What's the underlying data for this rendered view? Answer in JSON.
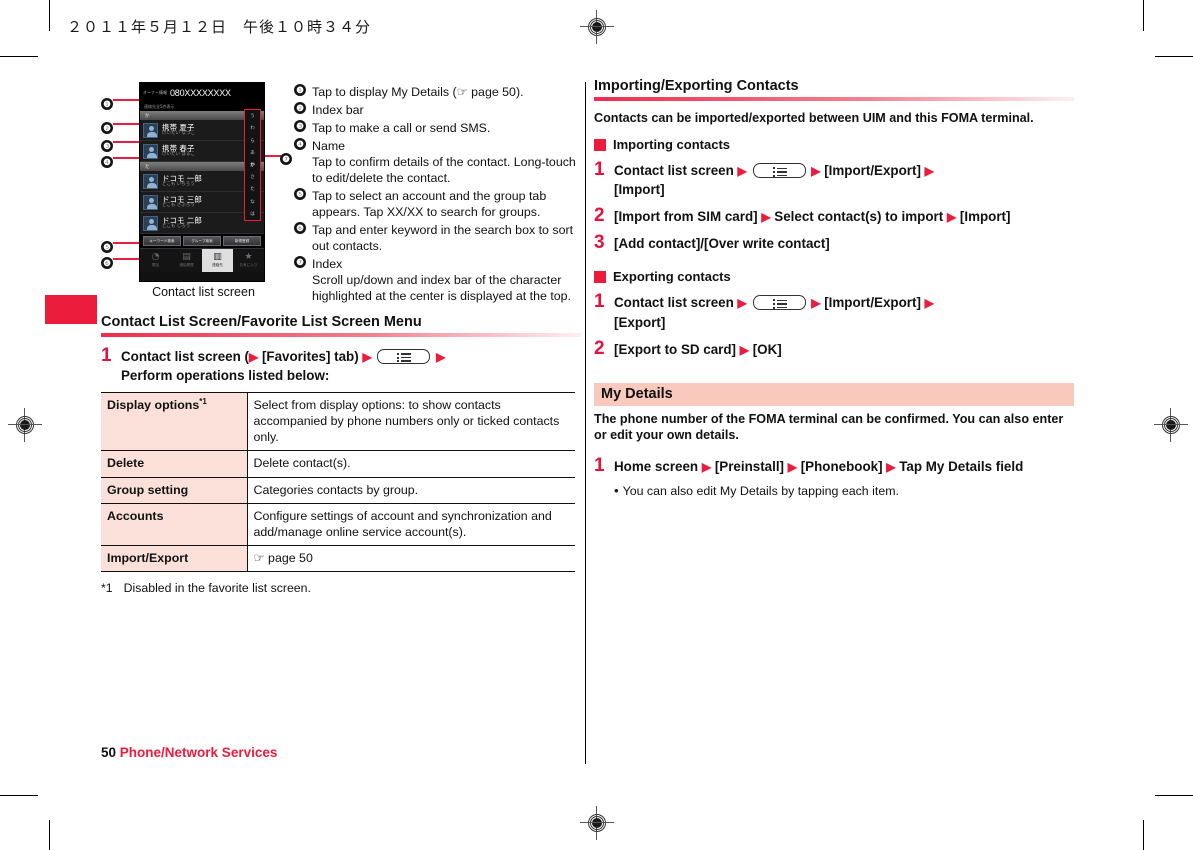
{
  "document": {
    "date_header": "２０１１年５月１２日　午後１０時３４分",
    "footer_page_number": "50",
    "footer_section": "Phone/Network Services"
  },
  "figure": {
    "caption": "Contact list screen",
    "phone": {
      "owner_label": "オーナー情報",
      "owner_number": "080XXXXXXXX",
      "count_label": "連絡先全5件表示",
      "index_bar_1": "か",
      "index_bar_2": "た",
      "contacts": [
        {
          "name": "携帯 夏子",
          "reading": "けいたい なつこ"
        },
        {
          "name": "携帯 春子",
          "reading": "けいたい はるこ"
        },
        {
          "name": "ドコモ 一郎",
          "reading": "どこも いちろう"
        },
        {
          "name": "ドコモ 三郎",
          "reading": "どこも さぶろう"
        },
        {
          "name": "ドコモ 二郎",
          "reading": "どこも じろう"
        }
      ],
      "buttons": [
        "キーワード検索",
        "グループ検索",
        "新規登録"
      ],
      "tabs": [
        {
          "label": "電話",
          "icon": "phone-icon"
        },
        {
          "label": "通話履歴",
          "icon": "list-icon"
        },
        {
          "label": "連絡先",
          "icon": "contacts-icon"
        },
        {
          "label": "お気に入り",
          "icon": "star-icon"
        }
      ],
      "index_letters": [
        "う",
        "わ",
        "ら",
        "あ",
        "か",
        "さ",
        "た",
        "な",
        "は"
      ],
      "index_highlight": "か"
    },
    "callouts": [
      {
        "num": "❶",
        "text": "Tap to display My Details (☞ page 50)."
      },
      {
        "num": "❷",
        "text": "Index bar"
      },
      {
        "num": "❸",
        "text": "Tap to make a call or send SMS."
      },
      {
        "num": "❹",
        "text": "Name",
        "sub": "Tap to confirm details of the contact. Long-touch to edit/delete the contact."
      },
      {
        "num": "❺",
        "text": "Tap to select an account and the group tab appears. Tap XX/XX to search for groups."
      },
      {
        "num": "❻",
        "text": "Tap and enter keyword in the search box to sort out contacts."
      },
      {
        "num": "❼",
        "text": "Index",
        "sub": "Scroll up/down and index bar of the character highlighted at the center is displayed at the top."
      }
    ]
  },
  "left_section": {
    "heading": "Contact List Screen/Favorite List Screen Menu",
    "step1": {
      "number": "1",
      "part_a": "Contact list screen (",
      "part_b": "[Favorites] tab)",
      "part_c": "Perform operations listed below:",
      "triangle": "▶",
      "menu_key_icon": "menu-key-icon"
    },
    "table": {
      "rows": [
        {
          "key": "Display options",
          "key_footnote": "*1",
          "value": "Select from display options: to show contacts accompanied by phone numbers only or ticked contacts only."
        },
        {
          "key": "Delete",
          "key_footnote": "",
          "value": "Delete contact(s)."
        },
        {
          "key": "Group setting",
          "key_footnote": "",
          "value": "Categories contacts by group."
        },
        {
          "key": "Accounts",
          "key_footnote": "",
          "value": "Configure settings of account and synchronization and add/manage online service account(s)."
        },
        {
          "key": "Import/Export",
          "key_footnote": "",
          "value": "☞ page 50"
        }
      ]
    },
    "footnote": {
      "marker": "*1",
      "text": "Disabled in the favorite list screen."
    }
  },
  "right_section": {
    "heading": "Importing/Exporting Contacts",
    "lead": "Contacts can be imported/exported between UIM and this FOMA terminal.",
    "importing": {
      "sub_heading": "Importing contacts",
      "steps": [
        {
          "number": "1",
          "a": "Contact list screen",
          "b": "[Import/Export]",
          "c": "[Import]"
        },
        {
          "number": "2",
          "a": "[Import from SIM card]",
          "b": "Select contact(s) to import",
          "c": "[Import]"
        },
        {
          "number": "3",
          "a": "[Add contact]/[Over write contact]"
        }
      ]
    },
    "exporting": {
      "sub_heading": "Exporting contacts",
      "steps": [
        {
          "number": "1",
          "a": "Contact list screen",
          "b": "[Import/Export]",
          "c": "[Export]"
        },
        {
          "number": "2",
          "a": "[Export to SD card]",
          "b": "[OK]"
        }
      ]
    },
    "my_details": {
      "heading": "My Details",
      "lead": "The phone number of the FOMA terminal can be confirmed. You can also enter or edit your own details.",
      "step": {
        "number": "1",
        "a": "Home screen",
        "b": "[Preinstall]",
        "c": "[Phonebook]",
        "d": "Tap My Details field"
      },
      "bullet": "You can also edit My Details by tapping each item."
    }
  },
  "colors": {
    "accent_red": "#ec1c3c",
    "rule_red": "#ee2d4e",
    "table_key_bg": "#fae0d9",
    "tint_box_bg": "#f9c9bd"
  }
}
